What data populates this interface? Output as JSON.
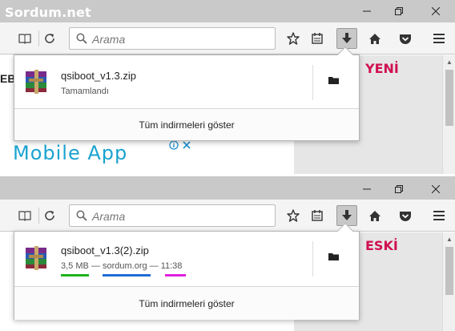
{
  "brand": {
    "watermark": "Sordum.net"
  },
  "toolbar": {
    "search_placeholder": "Arama"
  },
  "new_version": {
    "caption": "YENİ",
    "file_name": "qsiboot_v1.3.zip",
    "status": "Tamamlandı",
    "show_all": "Tüm indirmeleri göster"
  },
  "old_version": {
    "caption": "ESKİ",
    "file_name": "qsiboot_v1.3(2).zip",
    "status": "3,5 MB — sordum.org — 11:38",
    "show_all": "Tüm indirmeleri göster",
    "underline_colors": [
      "#1db31d",
      "#1e6ed6",
      "#e020e0"
    ]
  },
  "page": {
    "fragment_text": "EB",
    "ad_text": "Mobile App"
  },
  "icons": [
    "reader-view-icon",
    "reload-icon",
    "search-icon",
    "star-icon",
    "library-icon",
    "download-icon",
    "home-icon",
    "pocket-icon",
    "menu-icon",
    "archive-icon",
    "folder-icon",
    "minimize-icon",
    "restore-icon",
    "close-icon",
    "ad-info-icon",
    "ad-close-icon"
  ],
  "colors": {
    "caption": "#d01050",
    "ad_text": "#1aa3d0"
  }
}
